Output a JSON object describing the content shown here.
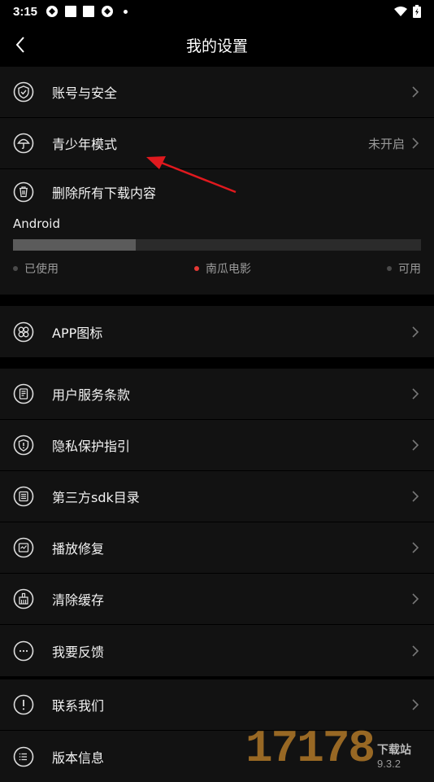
{
  "status_bar": {
    "time": "3:15",
    "icons": [
      "notification-icon",
      "square-icon",
      "square-icon",
      "notification-icon",
      "dot-icon"
    ],
    "right_icons": [
      "wifi-icon",
      "battery-icon"
    ]
  },
  "header": {
    "title": "我的设置"
  },
  "account_section": {
    "items": [
      {
        "label": "账号与安全",
        "icon": "shield-check-icon",
        "value": ""
      },
      {
        "label": "青少年模式",
        "icon": "umbrella-icon",
        "value": "未开启"
      }
    ]
  },
  "download_section": {
    "label": "删除所有下载内容",
    "icon": "trash-icon",
    "storage_title": "Android",
    "used_fraction": 0.3,
    "legend": [
      {
        "label": "已使用",
        "color": "#4a4a4a"
      },
      {
        "label": "南瓜电影",
        "color": "#e53935"
      },
      {
        "label": "可用",
        "color": "#4a4a4a"
      }
    ]
  },
  "app_icon_section": {
    "label": "APP图标",
    "icon": "grid-icon"
  },
  "info_section": {
    "items": [
      {
        "label": "用户服务条款",
        "icon": "document-icon"
      },
      {
        "label": "隐私保护指引",
        "icon": "privacy-shield-icon"
      },
      {
        "label": "第三方sdk目录",
        "icon": "list-icon"
      },
      {
        "label": "播放修复",
        "icon": "repair-icon"
      },
      {
        "label": "清除缓存",
        "icon": "broom-icon"
      },
      {
        "label": "我要反馈",
        "icon": "feedback-icon"
      }
    ]
  },
  "contact_section": {
    "items": [
      {
        "label": "联系我们",
        "icon": "info-exclaim-icon"
      },
      {
        "label": "版本信息",
        "icon": "menu-icon"
      }
    ]
  },
  "watermark": {
    "digits": "17178",
    "cn": "下载站",
    "com": "9.3.2"
  },
  "colors": {
    "background": "#000000",
    "row": "#121212",
    "accent": "#e53935",
    "annotation": "#e0191e"
  }
}
